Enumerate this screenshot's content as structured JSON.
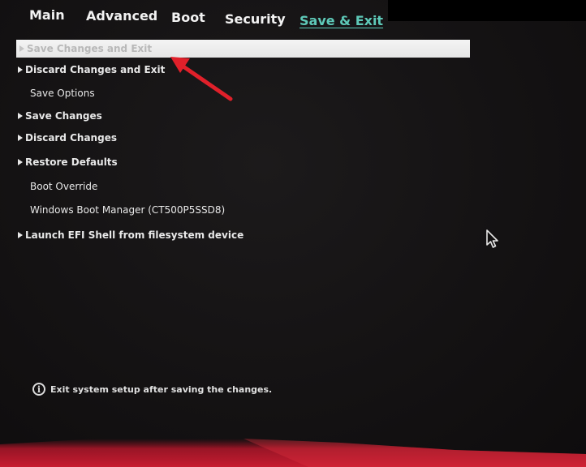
{
  "tabs": [
    {
      "label": "Main"
    },
    {
      "label": "Advanced"
    },
    {
      "label": "Boot"
    },
    {
      "label": "Security"
    },
    {
      "label": "Save & Exit",
      "active": true
    }
  ],
  "menu": {
    "items": [
      {
        "label": "Save Changes and Exit",
        "has_submenu": true,
        "selected": true
      },
      {
        "label": "Discard Changes and Exit",
        "has_submenu": true
      },
      {
        "label": "Save Options",
        "has_submenu": false
      },
      {
        "label": "Save Changes",
        "has_submenu": true
      },
      {
        "label": "Discard Changes",
        "has_submenu": true
      },
      {
        "label": "Restore Defaults",
        "has_submenu": true
      },
      {
        "label": "Boot Override",
        "has_submenu": false
      },
      {
        "label": "Windows Boot Manager (CT500P5SSD8)",
        "has_submenu": false
      },
      {
        "label": "Launch EFI Shell from filesystem device",
        "has_submenu": true
      }
    ]
  },
  "help": {
    "icon": "info-icon",
    "text": "Exit system setup after saving the changes."
  },
  "colors": {
    "background": "#141213",
    "active_tab": "#5ec9b8",
    "highlight": "#f0f0f0",
    "callout_arrow": "#e0202a",
    "bottom_glow": "#c0182a"
  }
}
